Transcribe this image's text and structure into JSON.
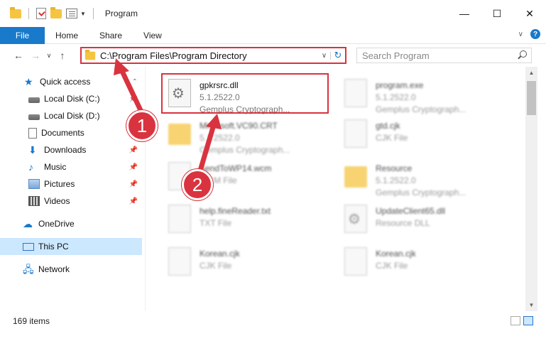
{
  "window": {
    "title": "Program"
  },
  "ribbon": {
    "tabs": [
      "File",
      "Home",
      "Share",
      "View"
    ]
  },
  "nav": {
    "address": "C:\\Program Files\\Program Directory",
    "search_placeholder": "Search Program"
  },
  "sidebar": {
    "items": [
      {
        "label": "Quick access",
        "icon": "star-icon"
      },
      {
        "label": "Local Disk (C:)",
        "icon": "drive-icon"
      },
      {
        "label": "Local Disk (D:)",
        "icon": "drive-icon"
      },
      {
        "label": "Documents",
        "icon": "documents-icon"
      },
      {
        "label": "Downloads",
        "icon": "downloads-icon"
      },
      {
        "label": "Music",
        "icon": "music-icon"
      },
      {
        "label": "Pictures",
        "icon": "pictures-icon"
      },
      {
        "label": "Videos",
        "icon": "videos-icon"
      },
      {
        "label": "OneDrive",
        "icon": "cloud-icon"
      },
      {
        "label": "This PC",
        "icon": "computer-icon"
      },
      {
        "label": "Network",
        "icon": "network-icon"
      }
    ],
    "selected": "This PC"
  },
  "files": [
    {
      "name": "gpkrsrc.dll",
      "line2": "5.1.2522.0",
      "line3": "Gemplus Cryptograph...",
      "icon": "dll-gear-icon"
    },
    {
      "name": "program.exe",
      "line2": "5.1.2522.0",
      "line3": "Gemplus Cryptograph...",
      "icon": "exe-icon"
    },
    {
      "name": "Microsoft.VC90.CRT",
      "line2": "5.1.2522.0",
      "line3": "Gemplus Cryptograph...",
      "icon": "folder-icon"
    },
    {
      "name": "gtd.cjk",
      "line2": "CJK File",
      "line3": "",
      "icon": "file-icon"
    },
    {
      "name": "SendToWP14.wcm",
      "line2": "WCM File",
      "line3": "",
      "icon": "file-icon"
    },
    {
      "name": "Resource",
      "line2": "5.1.2522.0",
      "line3": "Gemplus Cryptograph...",
      "icon": "folder-icon"
    },
    {
      "name": "help.fineReader.txt",
      "line2": "TXT File",
      "line3": "",
      "icon": "file-icon"
    },
    {
      "name": "UpdateClient65.dll",
      "line2": "Resource DLL",
      "line3": "",
      "icon": "dll-gear-icon"
    },
    {
      "name": "Korean.cjk",
      "line2": "CJK File",
      "line3": "",
      "icon": "file-icon"
    },
    {
      "name": "Korean.cjk",
      "line2": "CJK File",
      "line3": "",
      "icon": "file-icon"
    }
  ],
  "status": {
    "item_count": "169 items"
  },
  "callouts": [
    "1",
    "2"
  ],
  "colors": {
    "accent": "#1979ca",
    "callout": "#d9333f",
    "selected": "#cce8ff"
  }
}
